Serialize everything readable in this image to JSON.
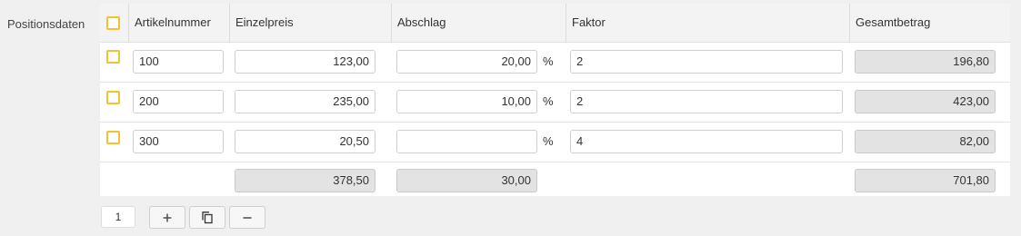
{
  "section_label": "Positionsdaten",
  "columns": {
    "artikelnummer": "Artikelnummer",
    "einzelpreis": "Einzelpreis",
    "abschlag": "Abschlag",
    "faktor": "Faktor",
    "gesamtbetrag": "Gesamtbetrag"
  },
  "rows": [
    {
      "artikelnummer": "100",
      "einzelpreis": "123,00",
      "abschlag": "20,00",
      "percent": "%",
      "faktor": "2",
      "gesamtbetrag": "196,80"
    },
    {
      "artikelnummer": "200",
      "einzelpreis": "235,00",
      "abschlag": "10,00",
      "percent": "%",
      "faktor": "2",
      "gesamtbetrag": "423,00"
    },
    {
      "artikelnummer": "300",
      "einzelpreis": "20,50",
      "abschlag": "",
      "percent": "%",
      "faktor": "4",
      "gesamtbetrag": "82,00"
    }
  ],
  "totals": {
    "einzelpreis": "378,50",
    "abschlag": "30,00",
    "gesamtbetrag": "701,80"
  },
  "pager": {
    "page": "1"
  },
  "toolbar": {
    "add_icon": "plus-icon",
    "copy_icon": "copy-icon",
    "remove_icon": "minus-icon"
  },
  "colors": {
    "checkbox_border": "#f2c230",
    "readonly_bg": "#e3e3e3",
    "header_bg": "#f3f3f3"
  }
}
